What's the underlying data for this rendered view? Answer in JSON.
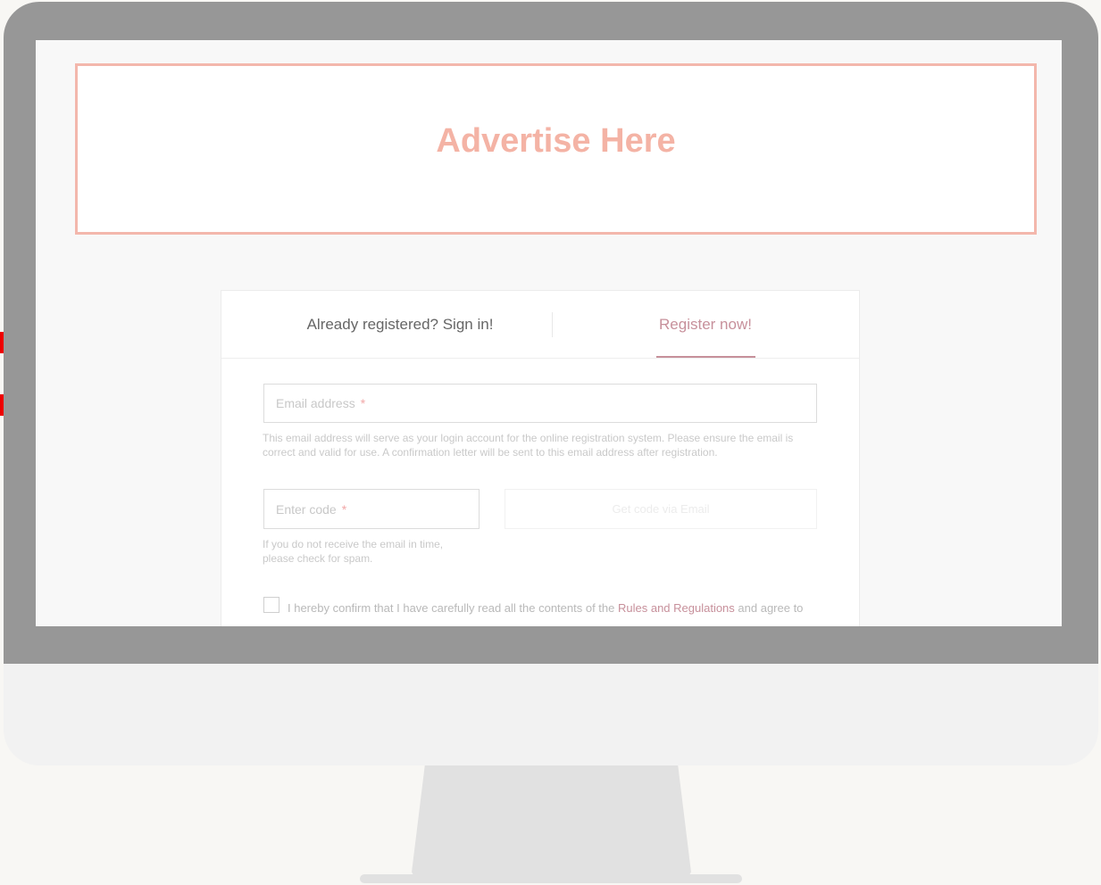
{
  "advert": {
    "text": "Advertise Here"
  },
  "tabs": {
    "signin": "Already registered? Sign in!",
    "register": "Register now!"
  },
  "form": {
    "email_placeholder": "Email address",
    "required_mark": "*",
    "email_hint": "This email address will serve as your login account for the online registration system. Please ensure the email is correct and valid for use. A confirmation letter will be sent to this email address after registration.",
    "code_placeholder": "Enter code",
    "code_button": "Get code via Email",
    "code_hint": "If you do not receive the email in time, please check for spam.",
    "consent_prefix": "I hereby confirm that I have carefully read all the contents of the ",
    "consent_link": "Rules and Regulations",
    "consent_suffix": " and agree to comply with them."
  },
  "colors": {
    "accent": "#c7909b",
    "advert": "#f4b3a5",
    "bezel": "#979797"
  }
}
